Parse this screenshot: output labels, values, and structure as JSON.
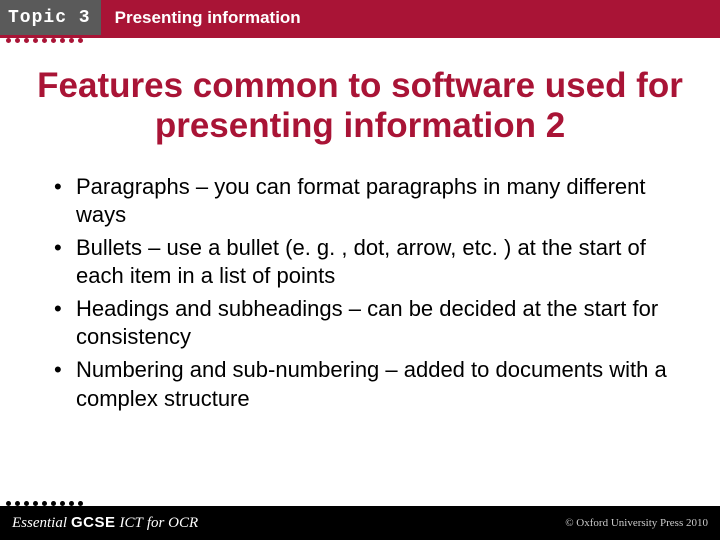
{
  "header": {
    "topic_label": "Topic 3",
    "title": "Presenting information"
  },
  "slide": {
    "title": "Features common to software used for presenting information 2",
    "bullets": [
      "Paragraphs – you can format paragraphs in many different ways",
      "Bullets – use a bullet (e. g. , dot, arrow, etc. ) at the start of each item in a list of points",
      "Headings and subheadings – can be decided at the start for consistency",
      "Numbering and sub-numbering – added to documents with a complex structure"
    ]
  },
  "footer": {
    "brand_essential": "Essential",
    "brand_gcse": "GCSE",
    "brand_ict": "ICT",
    "brand_for": "for OCR",
    "copyright": "© Oxford University Press 2010"
  }
}
